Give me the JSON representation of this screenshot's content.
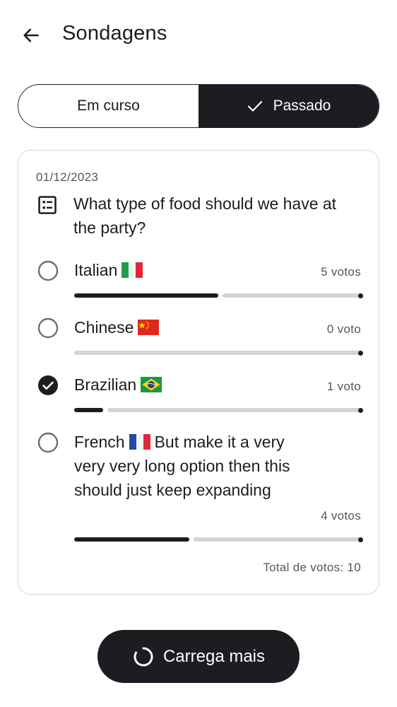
{
  "header": {
    "back_icon": "arrow-left-icon",
    "title": "Sondagens"
  },
  "tabs": [
    {
      "label": "Em curso",
      "selected": false
    },
    {
      "label": "Passado",
      "selected": true,
      "icon": "check-icon"
    }
  ],
  "poll": {
    "date": "01/12/2023",
    "icon": "poll-list-icon",
    "question": "What type of food should we have at the party?",
    "options": [
      {
        "label": "Italian",
        "flag": "italy-flag",
        "votes_label": "5 votos",
        "votes": 5,
        "selected": false
      },
      {
        "label": "Chinese",
        "flag": "china-flag",
        "votes_label": "0 voto",
        "votes": 0,
        "selected": false
      },
      {
        "label": "Brazilian",
        "flag": "brazil-flag",
        "votes_label": "1 voto",
        "votes": 1,
        "selected": true
      },
      {
        "label_before_flag": "French",
        "label_after_flag": "But make it a very very very long option then this should just keep expanding",
        "flag": "france-flag",
        "votes_label": "4 votos",
        "votes": 4,
        "selected": false
      }
    ],
    "total_votes_label": "Total de votos: 10",
    "total_votes": 10
  },
  "load_more": {
    "label": "Carrega mais",
    "icon": "loading-spinner-icon"
  },
  "colors": {
    "primary": "#1c1d21",
    "track": "#d1d4da",
    "muted_text": "#55575e",
    "card_border": "#d6d7db"
  }
}
